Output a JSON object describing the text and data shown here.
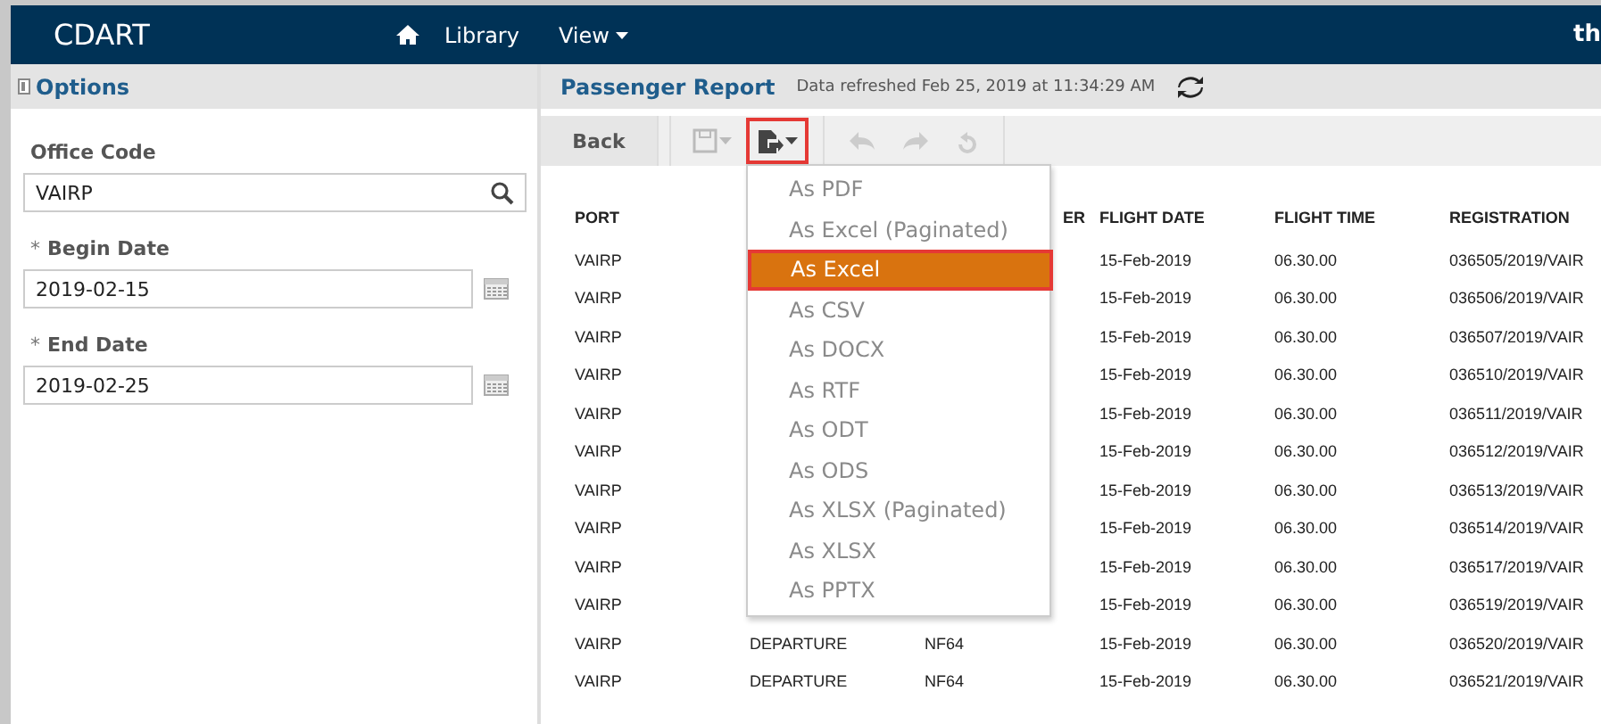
{
  "nav": {
    "brand": "CDART",
    "items": [
      {
        "label": "Library",
        "kind": "link"
      },
      {
        "label": "View",
        "kind": "menu"
      }
    ],
    "user": "th"
  },
  "options": {
    "title": "Options",
    "fields": [
      {
        "label": "Office Code",
        "required": false,
        "value": "VAIRP",
        "kind": "search"
      },
      {
        "label": "Begin Date",
        "required": true,
        "value": "2019-02-15",
        "kind": "date"
      },
      {
        "label": "End Date",
        "required": true,
        "value": "2019-02-25",
        "kind": "date"
      }
    ],
    "required_mark": "*"
  },
  "report": {
    "title": "Passenger Report",
    "refreshed": "Data refreshed Feb 25, 2019 at 11:34:29 AM"
  },
  "toolbar": {
    "back": "Back",
    "export_open": true
  },
  "export_menu": [
    {
      "label": "As PDF",
      "selected": false
    },
    {
      "label": "As Excel (Paginated)",
      "selected": false
    },
    {
      "label": "As Excel",
      "selected": true
    },
    {
      "label": "As CSV",
      "selected": false
    },
    {
      "label": "As DOCX",
      "selected": false
    },
    {
      "label": "As RTF",
      "selected": false
    },
    {
      "label": "As ODT",
      "selected": false
    },
    {
      "label": "As ODS",
      "selected": false
    },
    {
      "label": "As XLSX (Paginated)",
      "selected": false
    },
    {
      "label": "As XLSX",
      "selected": false
    },
    {
      "label": "As PPTX",
      "selected": false
    }
  ],
  "table": {
    "columns": [
      "PORT",
      null,
      "ER",
      "FLIGHT DATE",
      "FLIGHT TIME",
      "REGISTRATION"
    ],
    "rows": [
      [
        "VAIRP",
        null,
        null,
        "15-Feb-2019",
        "06.30.00",
        "036505/2019/VAIR"
      ],
      [
        "VAIRP",
        null,
        null,
        "15-Feb-2019",
        "06.30.00",
        "036506/2019/VAIR"
      ],
      [
        "VAIRP",
        null,
        null,
        "15-Feb-2019",
        "06.30.00",
        "036507/2019/VAIR"
      ],
      [
        "VAIRP",
        null,
        null,
        "15-Feb-2019",
        "06.30.00",
        "036510/2019/VAIR"
      ],
      [
        "VAIRP",
        null,
        null,
        "15-Feb-2019",
        "06.30.00",
        "036511/2019/VAIR"
      ],
      [
        "VAIRP",
        null,
        null,
        "15-Feb-2019",
        "06.30.00",
        "036512/2019/VAIR"
      ],
      [
        "VAIRP",
        null,
        null,
        "15-Feb-2019",
        "06.30.00",
        "036513/2019/VAIR"
      ],
      [
        "VAIRP",
        null,
        null,
        "15-Feb-2019",
        "06.30.00",
        "036514/2019/VAIR"
      ],
      [
        "VAIRP",
        null,
        null,
        "15-Feb-2019",
        "06.30.00",
        "036517/2019/VAIR"
      ],
      [
        "VAIRP",
        null,
        null,
        "15-Feb-2019",
        "06.30.00",
        "036519/2019/VAIR"
      ],
      [
        "VAIRP",
        "DEPARTURE",
        "NF64",
        "15-Feb-2019",
        "06.30.00",
        "036520/2019/VAIR"
      ],
      [
        "VAIRP",
        "DEPARTURE",
        "NF64",
        "15-Feb-2019",
        "06.30.00",
        "036521/2019/VAIR"
      ]
    ]
  }
}
